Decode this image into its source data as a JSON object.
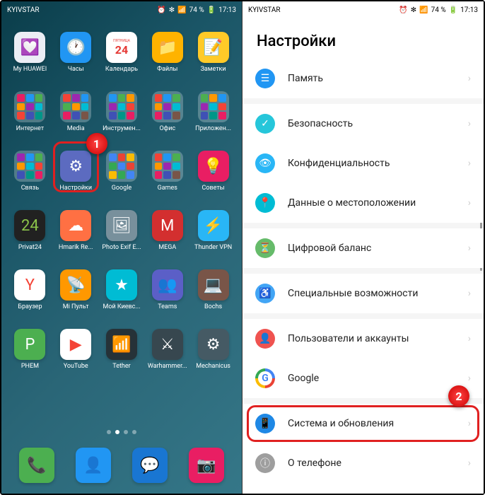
{
  "status": {
    "carrier": "KYIVSTAR",
    "bluetooth": "✻",
    "signal": "📶",
    "battery_pct": "74 %",
    "time": "17:13"
  },
  "home": {
    "rows": [
      [
        {
          "label": "My HUAWEI",
          "bg": "#ebeef5",
          "glyph": "💟"
        },
        {
          "label": "Часы",
          "bg": "#2196f3",
          "glyph": "🕐"
        },
        {
          "label": "Календарь",
          "bg": "#ffffff",
          "glyph": "24",
          "text": "#e53935",
          "sub": "ПЯТНИЦА"
        },
        {
          "label": "Файлы",
          "bg": "#ffb300",
          "glyph": "📁"
        },
        {
          "label": "Заметки",
          "bg": "#ffca28",
          "glyph": "📝"
        }
      ],
      [
        {
          "label": "Интернет",
          "folder": true,
          "colors": [
            "#e91e63",
            "#2196f3",
            "#4caf50",
            "#ff9800",
            "#9c27b0",
            "#00bcd4",
            "#f44336",
            "#3f51b5",
            "#009688"
          ]
        },
        {
          "label": "Media",
          "folder": true,
          "colors": [
            "#f44336",
            "#9c27b0",
            "#2196f3",
            "#4caf50",
            "#ff9800",
            "#00bcd4",
            "#e91e63",
            "#3f51b5",
            "#795548"
          ]
        },
        {
          "label": "Инструмен...",
          "folder": true,
          "colors": [
            "#2196f3",
            "#4caf50",
            "#ff9800",
            "#9c27b0",
            "#00bcd4",
            "#f44336",
            "#3f51b5",
            "#009688",
            "#e91e63"
          ]
        },
        {
          "label": "Офис",
          "folder": true,
          "colors": [
            "#f44336",
            "#2196f3",
            "#4caf50",
            "#ff9800",
            "#9c27b0",
            "#00bcd4",
            "#e91e63",
            "#3f51b5",
            "#795548"
          ]
        },
        {
          "label": "Приложен...",
          "folder": true,
          "colors": [
            "#4caf50",
            "#ff9800",
            "#2196f3",
            "#9c27b0",
            "#00bcd4",
            "#f44336",
            "#3f51b5",
            "#009688",
            "#e91e63"
          ]
        }
      ],
      [
        {
          "label": "Связь",
          "folder": true,
          "colors": [
            "#9c27b0",
            "#2196f3",
            "#4caf50",
            "#ff9800",
            "#00bcd4",
            "#f44336",
            "#3f51b5",
            "#009688",
            "#e91e63"
          ]
        },
        {
          "label": "Настройки",
          "bg": "#5c6bc0",
          "glyph": "⚙",
          "highlighted": true
        },
        {
          "label": "Google",
          "folder": true,
          "colors": [
            "#4285f4",
            "#ea4335",
            "#fbbc05",
            "#34a853",
            "#4285f4",
            "#ea4335",
            "#fbbc05",
            "#34a853",
            "#4285f4"
          ]
        },
        {
          "label": "Games",
          "folder": true,
          "colors": [
            "#f44336",
            "#2196f3",
            "#4caf50",
            "#ff9800",
            "#9c27b0",
            "#00bcd4",
            "#e91e63",
            "#3f51b5",
            "#795548"
          ]
        },
        {
          "label": "Советы",
          "bg": "#e91e63",
          "glyph": "💡"
        }
      ],
      [
        {
          "label": "Privat24",
          "bg": "#212121",
          "glyph": "24",
          "text": "#8bc34a"
        },
        {
          "label": "Hmarik Re...",
          "bg": "#ff7043",
          "glyph": "☁"
        },
        {
          "label": "Photo Exif E...",
          "bg": "#78909c",
          "glyph": "🖼"
        },
        {
          "label": "MEGA",
          "bg": "#d32f2f",
          "glyph": "M"
        },
        {
          "label": "Thunder VPN",
          "bg": "#29b6f6",
          "glyph": "⚡"
        }
      ],
      [
        {
          "label": "Браузер",
          "bg": "#ffffff",
          "glyph": "Y",
          "text": "#f44336"
        },
        {
          "label": "Mi Пульт",
          "bg": "#ff9800",
          "glyph": "📡"
        },
        {
          "label": "Мой Киевс...",
          "bg": "#00bcd4",
          "glyph": "★"
        },
        {
          "label": "Teams",
          "bg": "#5b5fc7",
          "glyph": "👥"
        },
        {
          "label": "Bochs",
          "bg": "#795548",
          "glyph": "💻"
        }
      ],
      [
        {
          "label": "PHEM",
          "bg": "#4caf50",
          "glyph": "P"
        },
        {
          "label": "YouTube",
          "bg": "#ffffff",
          "glyph": "▶",
          "text": "#f44336"
        },
        {
          "label": "Tether",
          "bg": "#263238",
          "glyph": "📶"
        },
        {
          "label": "Warhammer...",
          "bg": "#37474f",
          "glyph": "⚔"
        },
        {
          "label": "Mechanicus",
          "bg": "#455a64",
          "glyph": "⚙"
        }
      ]
    ],
    "dock": [
      {
        "bg": "#4caf50",
        "glyph": "📞"
      },
      {
        "bg": "#2196f3",
        "glyph": "👤"
      },
      {
        "bg": "#1976d2",
        "glyph": "💬"
      },
      {
        "bg": "#e91e63",
        "glyph": "📷"
      }
    ]
  },
  "settings": {
    "title": "Настройки",
    "items": [
      {
        "label": "Память",
        "bg": "#2196f3",
        "glyph": "☰"
      },
      {
        "label": "Безопасность",
        "bg": "#26c6da",
        "glyph": "✓",
        "gap": true
      },
      {
        "label": "Конфиденциальность",
        "bg": "#29b6f6",
        "glyph": "👁"
      },
      {
        "label": "Данные о местоположении",
        "bg": "#00bcd4",
        "glyph": "📍"
      },
      {
        "label": "Цифровой баланс",
        "bg": "#66bb6a",
        "glyph": "⏳",
        "gap": true
      },
      {
        "label": "Специальные возможности",
        "bg": "#42a5f5",
        "glyph": "♿",
        "gap": true
      },
      {
        "label": "Пользователи и аккаунты",
        "bg": "#ef5350",
        "glyph": "👤",
        "gap": true
      },
      {
        "label": "Google",
        "bg": "#ffffff",
        "glyph": "G",
        "multicolor": true
      },
      {
        "label": "Система и обновления",
        "bg": "#1e88e5",
        "glyph": "📱",
        "highlighted": true,
        "gap": true
      },
      {
        "label": "О телефоне",
        "bg": "#9e9e9e",
        "glyph": "ⓘ"
      }
    ]
  },
  "markers": {
    "one": "1",
    "two": "2"
  }
}
